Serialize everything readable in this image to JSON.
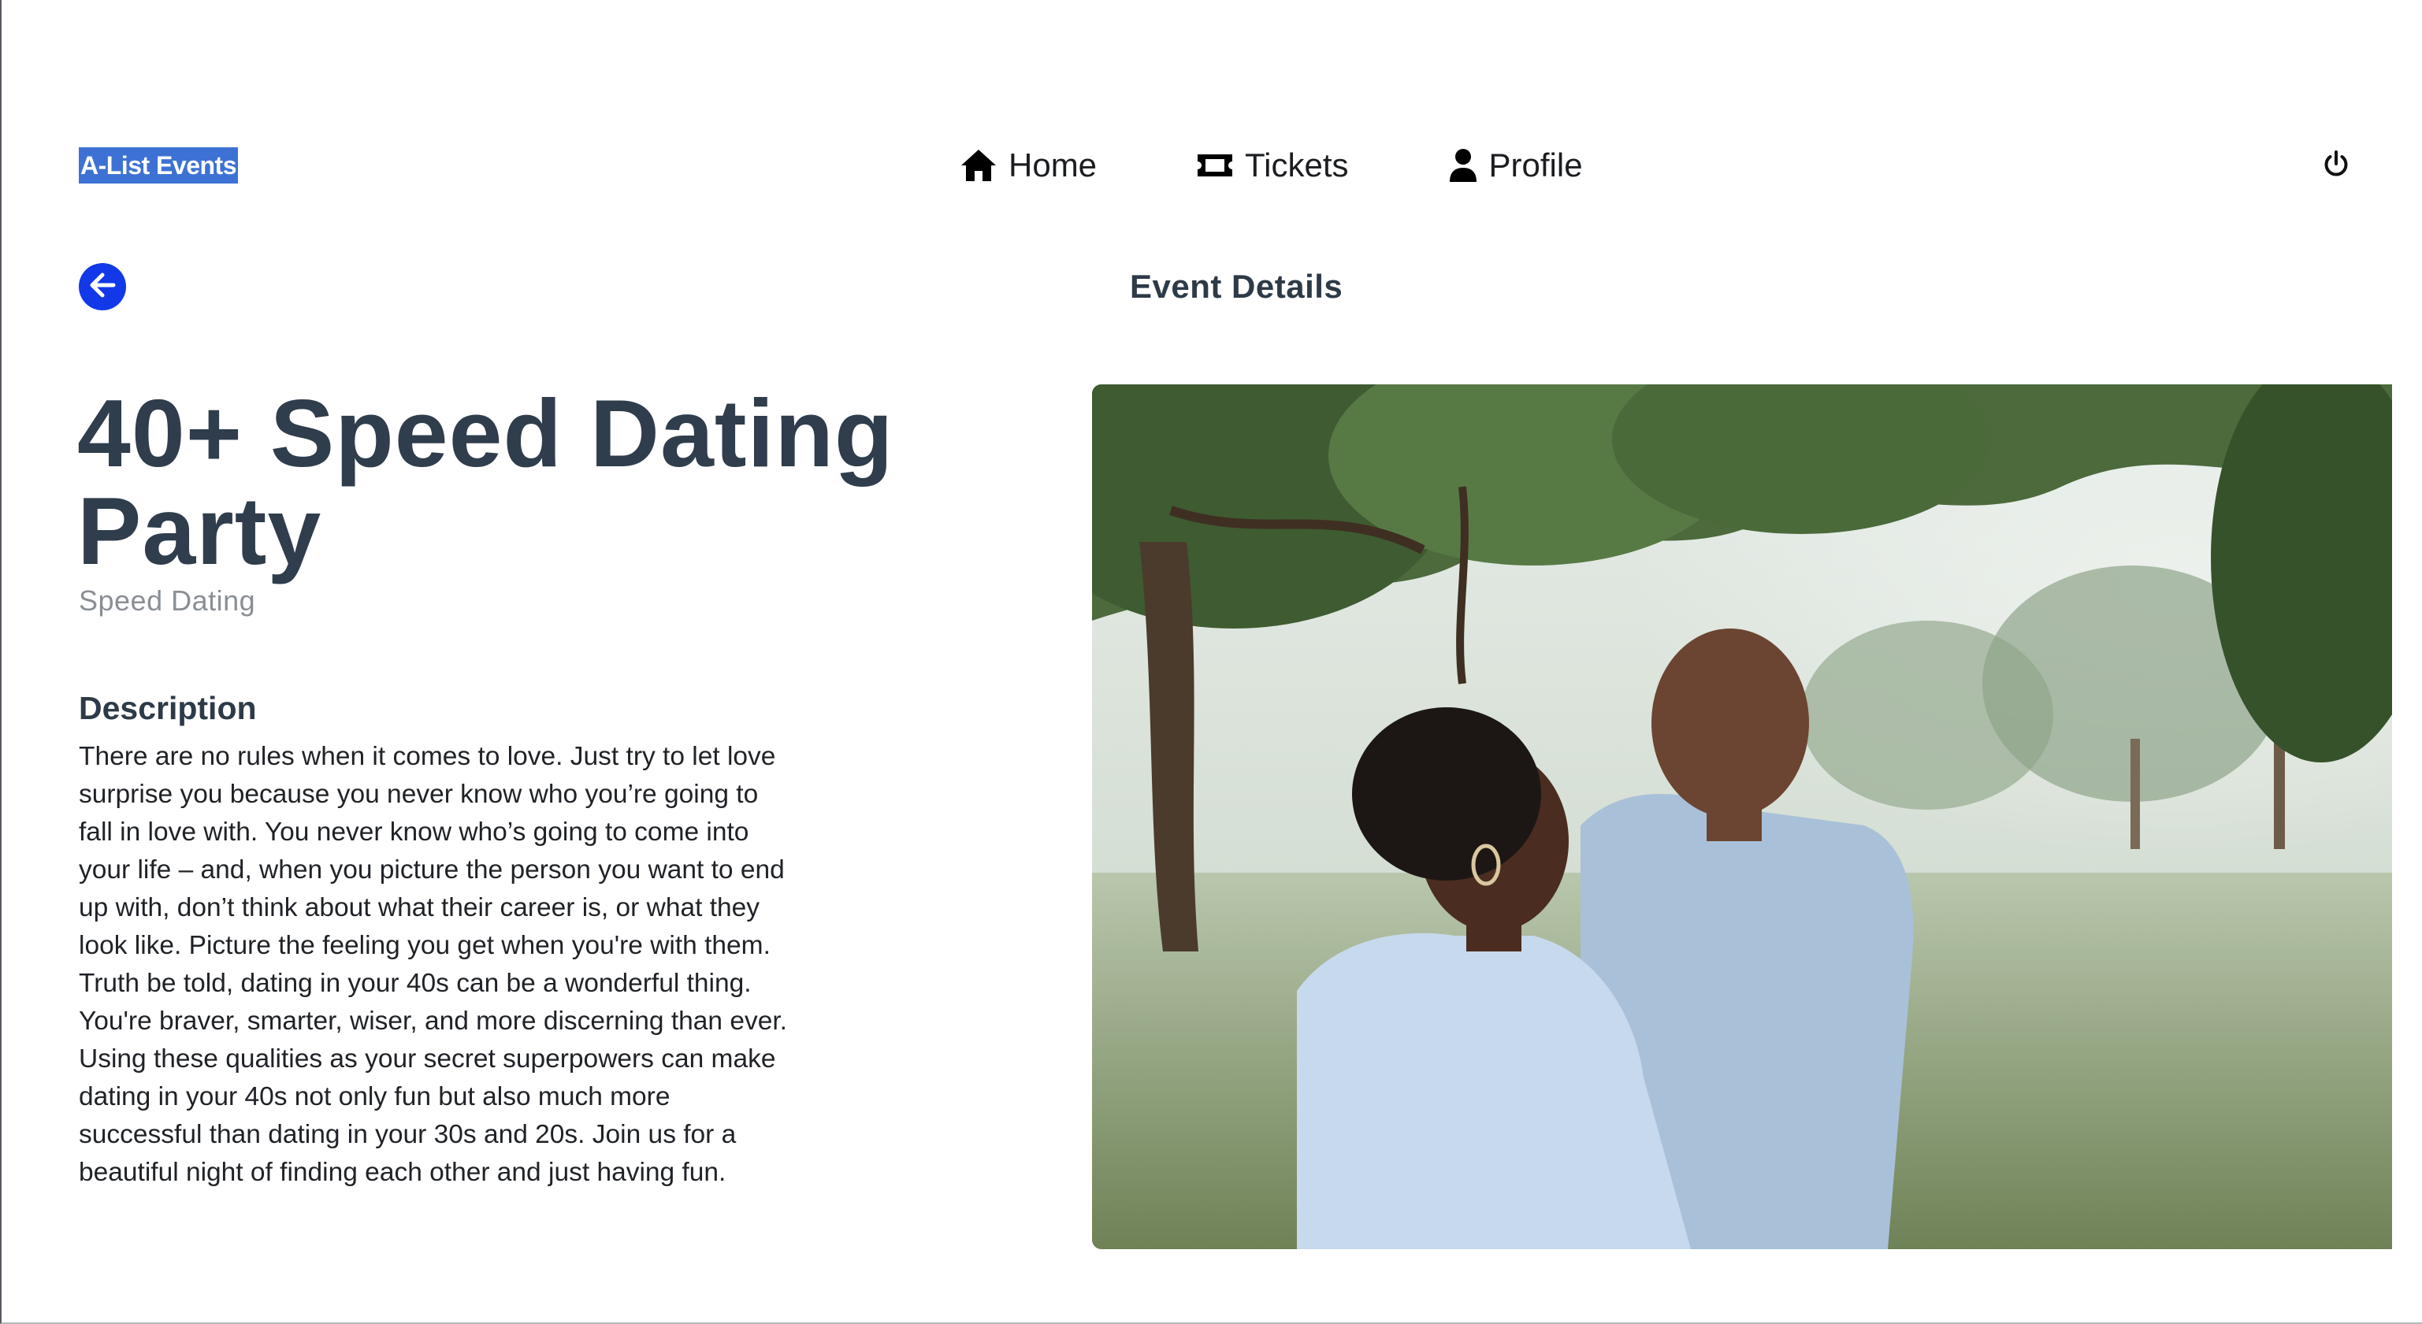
{
  "nav": {
    "brand": "A-List Events",
    "items": [
      {
        "icon": "home-icon",
        "label": "Home"
      },
      {
        "icon": "ticket-icon",
        "label": "Tickets"
      },
      {
        "icon": "user-icon",
        "label": "Profile"
      }
    ],
    "power_icon": "power-icon"
  },
  "header": {
    "back_icon": "arrow-left-icon",
    "section_title": "Event Details"
  },
  "event": {
    "title": "40+ Speed Dating Party",
    "category": "Speed Dating",
    "description_heading": "Description",
    "description": "There are no rules when it comes to love. Just try to let love surprise you because you never know who you’re going to fall in love with. You never know who’s going to come into your life – and, when you picture the person you want to end up with, don’t think about what their career is, or what they look like. Picture the feeling you get when you're with them. Truth be told, dating in your 40s can be a wonderful thing. You're braver, smarter, wiser, and more discerning than ever. Using these qualities as your secret superpowers can make dating in your 40s not only fun but also much more successful than dating in your 30s and 20s. Join us for a beautiful night of finding each other and just having fun."
  },
  "colors": {
    "brand_highlight": "#3d72d4",
    "back_button": "#1238e8",
    "heading_text": "#2f3d4c",
    "muted_text": "#8a8f95"
  }
}
